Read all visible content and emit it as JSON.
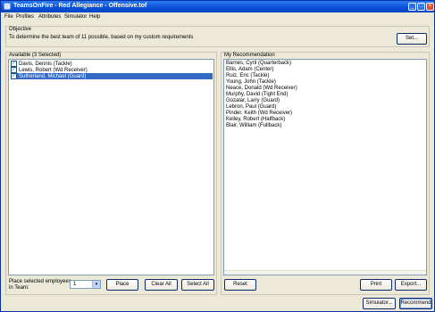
{
  "window": {
    "title": "TeamsOnFire - Red Allegiance - Offensive.tof",
    "minimize_glyph": "_",
    "maximize_glyph": "□",
    "close_glyph": "×"
  },
  "menu": [
    "File",
    "Profiles",
    "Attributes",
    "Simulator",
    "Help"
  ],
  "objective": {
    "heading": "Objective",
    "text": "To determine the best team of 11 possible, based on my custom requirements",
    "set_button": "Set..."
  },
  "available": {
    "heading": "Available (3 Selected)",
    "items": [
      {
        "label": "Davis, Dennis (Tackle)",
        "checked": true,
        "selected": false
      },
      {
        "label": "Lewis, Robert (Wd Receiver)",
        "checked": true,
        "selected": false
      },
      {
        "label": "Sutherland, Michael (Guard)",
        "checked": true,
        "selected": true
      }
    ],
    "check_glyph": "✓",
    "place_label_line1": "Place selected employees",
    "place_label_line2": "in Team:",
    "team_value": "1",
    "dropdown_glyph": "▾",
    "place_button": "Place",
    "clear_all_button": "Clear All",
    "select_all_button": "Select All"
  },
  "recommendation": {
    "heading": "My Recommendation",
    "items": [
      "Barnes, Cyril (Quarterback)",
      "Ellis, Adam (Center)",
      "Ruiz, Eric (Tackle)",
      "Young, John (Tackle)",
      "Neace, Donald (Wd Receiver)",
      "Murphy, David (Tight End)",
      "Gozalar, Larry (Guard)",
      "Lebron, Paul (Guard)",
      "Pinder, Keith (Wd Receiver)",
      "Kelley, Robert (Halfback)",
      "Blair, William (Fullback)"
    ],
    "reset_button": "Reset",
    "print_button": "Print",
    "export_button": "Export..."
  },
  "footer": {
    "simulator_button": "Simulator...",
    "recommend_button": "Recommend"
  }
}
